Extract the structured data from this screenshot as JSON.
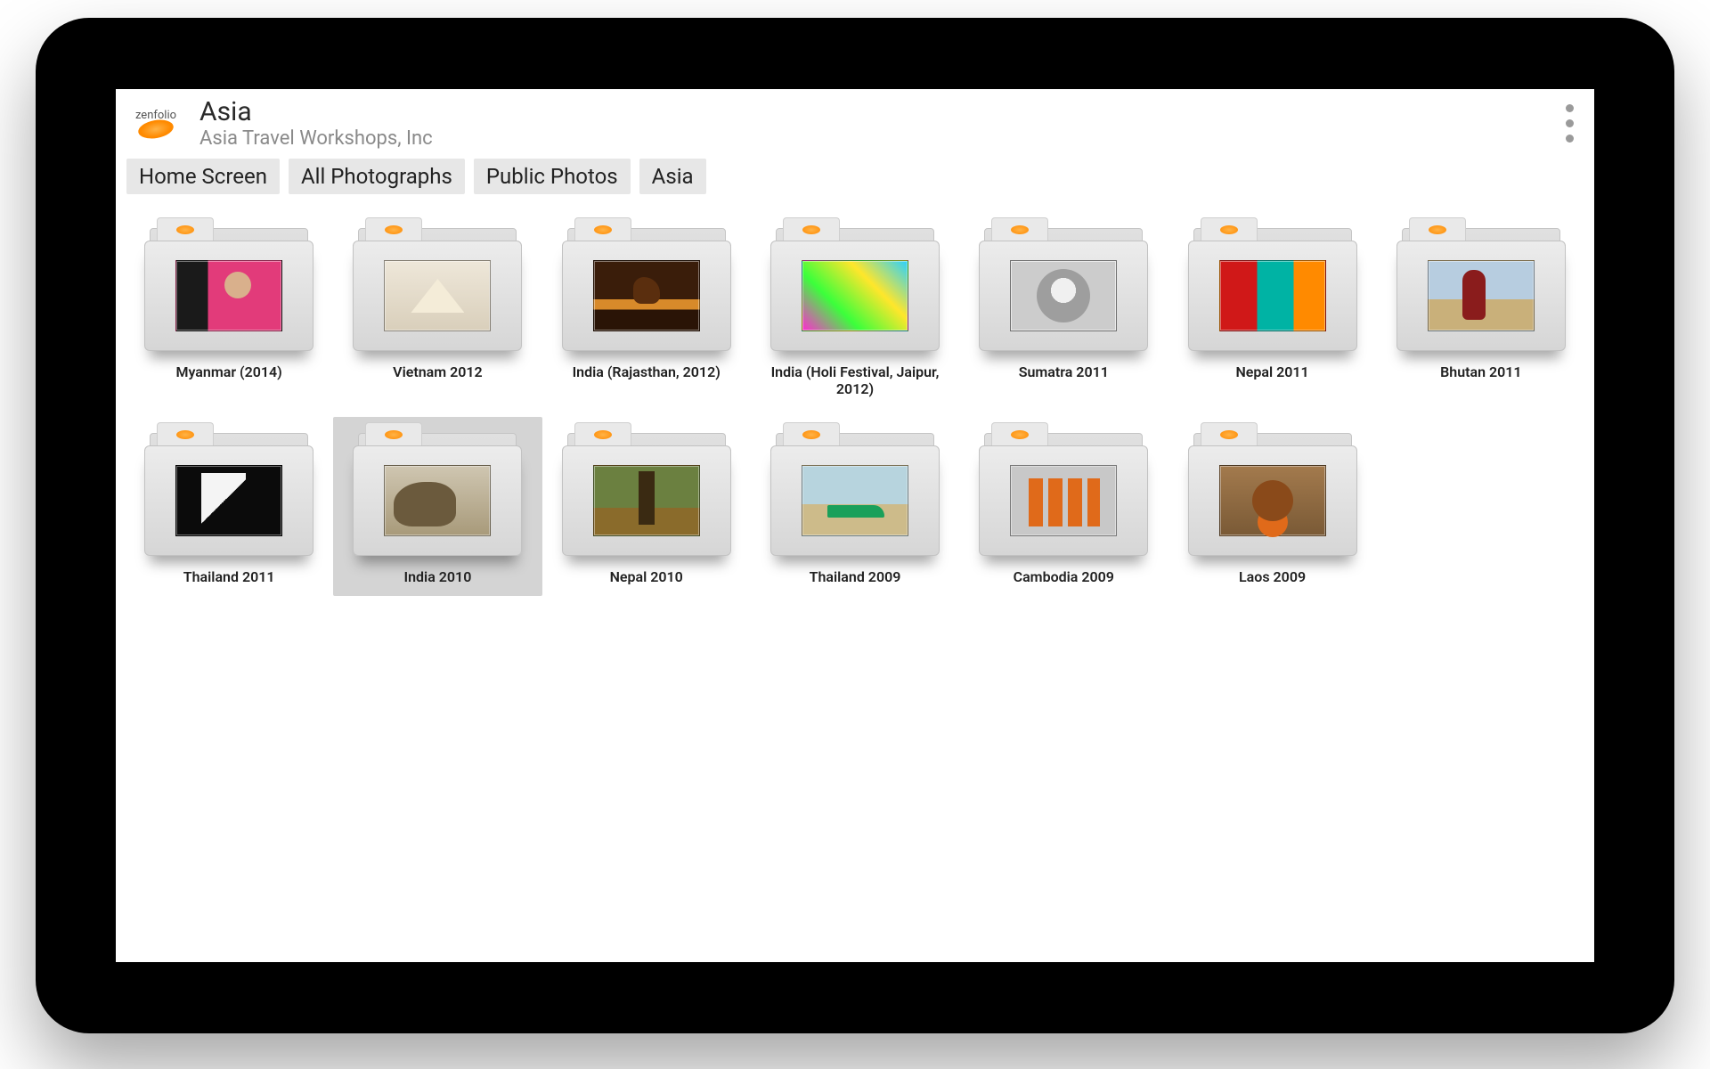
{
  "brand": {
    "name": "zenfolio"
  },
  "header": {
    "title": "Asia",
    "subtitle": "Asia Travel Workshops, Inc"
  },
  "breadcrumbs": [
    {
      "label": "Home Screen"
    },
    {
      "label": "All Photographs"
    },
    {
      "label": "Public Photos"
    },
    {
      "label": "Asia"
    }
  ],
  "folders": [
    {
      "label": "Myanmar (2014)",
      "thumb": "myanmar",
      "selected": false
    },
    {
      "label": "Vietnam 2012",
      "thumb": "vietnam",
      "selected": false
    },
    {
      "label": "India (Rajasthan, 2012)",
      "thumb": "rajasthan",
      "selected": false
    },
    {
      "label": "India (Holi Festival, Jaipur, 2012)",
      "thumb": "holi",
      "selected": false
    },
    {
      "label": "Sumatra 2011",
      "thumb": "sumatra",
      "selected": false
    },
    {
      "label": "Nepal 2011",
      "thumb": "nepal2011",
      "selected": false
    },
    {
      "label": "Bhutan 2011",
      "thumb": "bhutan",
      "selected": false
    },
    {
      "label": "Thailand 2011",
      "thumb": "thailand2011",
      "selected": false
    },
    {
      "label": "India 2010",
      "thumb": "india2010",
      "selected": true
    },
    {
      "label": "Nepal 2010",
      "thumb": "nepal2010",
      "selected": false
    },
    {
      "label": "Thailand 2009",
      "thumb": "thailand2009",
      "selected": false
    },
    {
      "label": "Cambodia 2009",
      "thumb": "cambodia",
      "selected": false
    },
    {
      "label": "Laos 2009",
      "thumb": "laos",
      "selected": false
    }
  ]
}
